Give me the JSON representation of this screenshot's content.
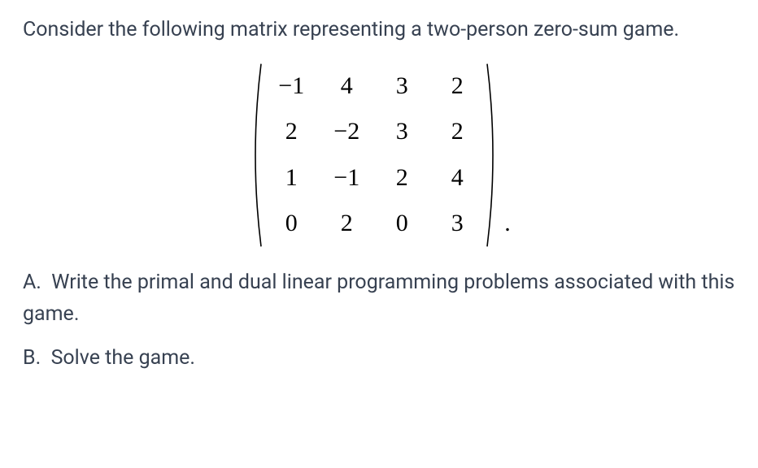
{
  "intro": "Consider the following matrix representing a two-person zero-sum game.",
  "matrix": {
    "rows": [
      [
        "−1",
        "4",
        "3",
        "2"
      ],
      [
        "2",
        "−2",
        "3",
        "2"
      ],
      [
        "1",
        "−1",
        "2",
        "4"
      ],
      [
        "0",
        "2",
        "0",
        "3"
      ]
    ]
  },
  "period": ".",
  "questionA": "A.  Write the primal and dual linear programming problems associated with this game.",
  "questionB": "B.  Solve the game."
}
